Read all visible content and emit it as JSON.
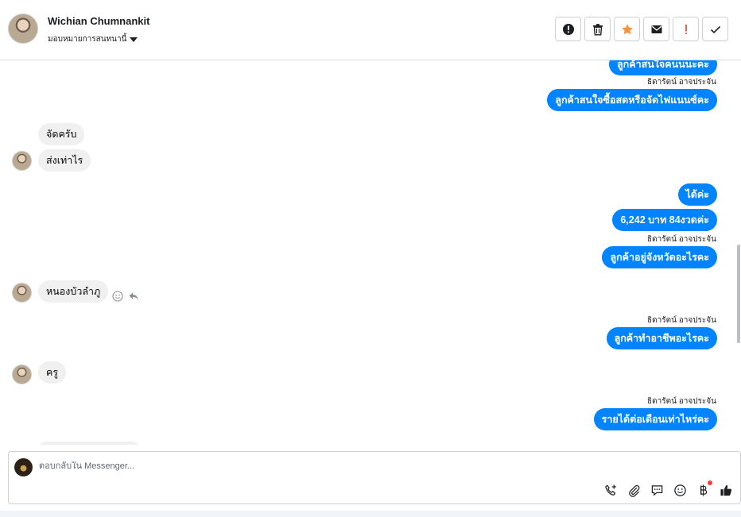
{
  "header": {
    "contact_name": "Wichian Chumnankit",
    "assign_label": "มอบหมายการสนทนานี้"
  },
  "actions": [
    {
      "name": "spam-button",
      "icon": "alert-circle-icon"
    },
    {
      "name": "delete-button",
      "icon": "trash-icon"
    },
    {
      "name": "star-button",
      "icon": "star-icon"
    },
    {
      "name": "mark-unread-button",
      "icon": "envelope-icon"
    },
    {
      "name": "important-button",
      "icon": "exclamation-icon"
    },
    {
      "name": "done-button",
      "icon": "checkmark-icon"
    }
  ],
  "thread": {
    "messages": [
      {
        "kind": "out",
        "text": "ลูกค้าสนใจคนนนะคะ"
      },
      {
        "kind": "sender",
        "text": "ธิดารัตน์ อาจประจัน"
      },
      {
        "kind": "out",
        "text": "ลูกค้าสนใจซื้อสดหรือจัดไฟแนนซ์คะ"
      },
      {
        "kind": "in",
        "text": "จัดครับ"
      },
      {
        "kind": "in",
        "text": "ส่งเท่าไร"
      },
      {
        "kind": "out",
        "text": "ได้ค่ะ"
      },
      {
        "kind": "out",
        "text": "6,242 บาท 84งวดค่ะ"
      },
      {
        "kind": "sender",
        "text": "ธิดารัตน์ อาจประจัน"
      },
      {
        "kind": "out",
        "text": "ลูกค้าอยู่จังหวัดอะไรคะ"
      },
      {
        "kind": "in",
        "text": "หนองบัวลำภู"
      },
      {
        "kind": "sender",
        "text": "ธิดารัตน์ อาจประจัน"
      },
      {
        "kind": "out",
        "text": "ลูกค้าทำอาชีพอะไรคะ"
      },
      {
        "kind": "in",
        "text": "ครู"
      },
      {
        "kind": "sender",
        "text": "ธิดารัตน์ อาจประจัน"
      },
      {
        "kind": "out",
        "text": "รายได้ต่อเดือนเท่าไหร่คะ"
      }
    ]
  },
  "composer": {
    "placeholder": "ตอบกลับใน Messenger...",
    "tools": [
      "phone-plus-icon",
      "paperclip-icon",
      "saved-reply-icon",
      "emoji-icon",
      "baht-icon",
      "like-icon"
    ]
  },
  "colors": {
    "outgoing_bubble": "#0084ff",
    "incoming_bubble": "#f0f0f0",
    "star": "#f7923b",
    "important": "#e4513c"
  }
}
